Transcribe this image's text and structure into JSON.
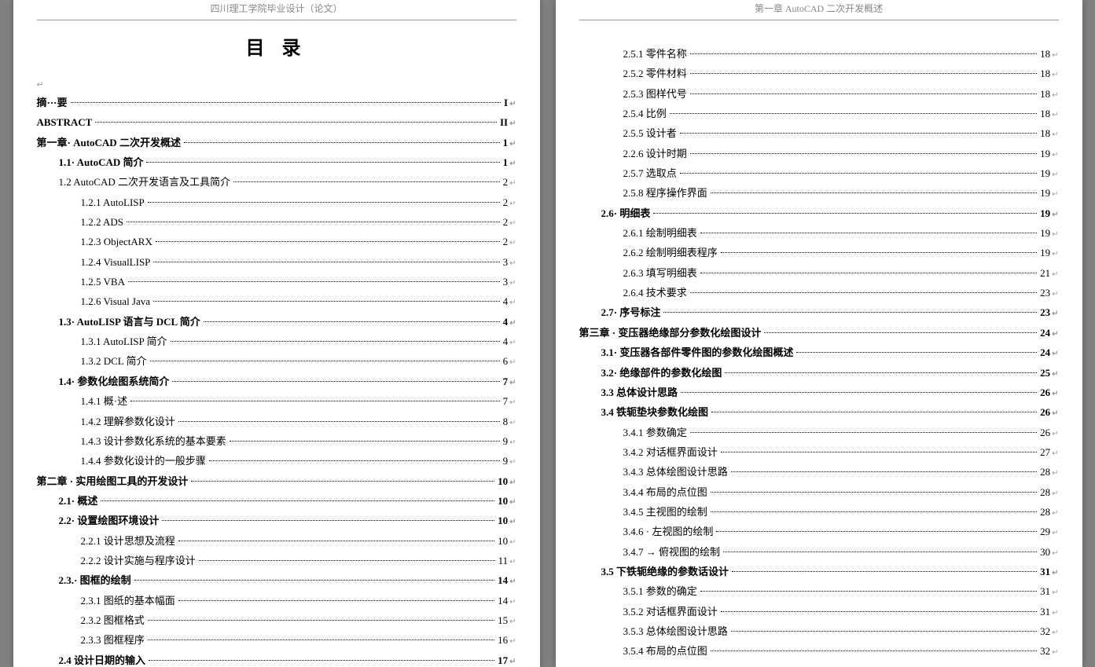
{
  "leftHeader": "四川理工学院毕业设计（论文）",
  "rightHeader": "第一章  AutoCAD 二次开发概述",
  "title": "目   录",
  "leftToc": [
    {
      "label": "摘···要",
      "page": "I",
      "indent": 0,
      "bold": true
    },
    {
      "label": "ABSTRACT",
      "page": "II",
      "indent": 0,
      "bold": true
    },
    {
      "label": "第一章· AutoCAD 二次开发概述",
      "page": "1",
      "indent": 0,
      "bold": true
    },
    {
      "label": "1.1· AutoCAD 简介",
      "page": "1",
      "indent": 1,
      "bold": true
    },
    {
      "label": "1.2 AutoCAD 二次开发语言及工具简介",
      "page": "2",
      "indent": 1,
      "bold": false
    },
    {
      "label": "1.2.1 AutoLISP",
      "page": "2",
      "indent": 2,
      "bold": false
    },
    {
      "label": "1.2.2 ADS",
      "page": "2",
      "indent": 2,
      "bold": false
    },
    {
      "label": "1.2.3 ObjectARX",
      "page": "2",
      "indent": 2,
      "bold": false
    },
    {
      "label": "1.2.4 VisualLISP",
      "page": "3",
      "indent": 2,
      "bold": false
    },
    {
      "label": "1.2.5 VBA",
      "page": "3",
      "indent": 2,
      "bold": false
    },
    {
      "label": "1.2.6 Visual Java",
      "page": "4",
      "indent": 2,
      "bold": false
    },
    {
      "label": "1.3· AutoLISP 语言与 DCL 简介",
      "page": "4",
      "indent": 1,
      "bold": true
    },
    {
      "label": "1.3.1 AutoLISP 简介",
      "page": "4",
      "indent": 2,
      "bold": false
    },
    {
      "label": "1.3.2 DCL 简介",
      "page": "6",
      "indent": 2,
      "bold": false
    },
    {
      "label": "1.4· 参数化绘图系统简介",
      "page": "7",
      "indent": 1,
      "bold": true
    },
    {
      "label": "1.4.1 概·述",
      "page": "7",
      "indent": 2,
      "bold": false
    },
    {
      "label": "1.4.2 理解参数化设计",
      "page": "8",
      "indent": 2,
      "bold": false
    },
    {
      "label": "1.4.3 设计参数化系统的基本要素",
      "page": "9",
      "indent": 2,
      "bold": false
    },
    {
      "label": "1.4.4 参数化设计的一般步骤",
      "page": "9",
      "indent": 2,
      "bold": false
    },
    {
      "label": "第二章 · 实用绘图工具的开发设计",
      "page": "10",
      "indent": 0,
      "bold": true
    },
    {
      "label": "2.1· 概述",
      "page": "10",
      "indent": 1,
      "bold": true
    },
    {
      "label": "2.2· 设置绘图环境设计",
      "page": "10",
      "indent": 1,
      "bold": true
    },
    {
      "label": "2.2.1 设计思想及流程",
      "page": "10",
      "indent": 2,
      "bold": false
    },
    {
      "label": "2.2.2 设计实施与程序设计",
      "page": "11",
      "indent": 2,
      "bold": false
    },
    {
      "label": "2.3.· 图框的绘制",
      "page": "14",
      "indent": 1,
      "bold": true
    },
    {
      "label": "2.3.1 图纸的基本幅面",
      "page": "14",
      "indent": 2,
      "bold": false
    },
    {
      "label": "2.3.2 图框格式",
      "page": "15",
      "indent": 2,
      "bold": false
    },
    {
      "label": "2.3.3 图框程序",
      "page": "16",
      "indent": 2,
      "bold": false
    },
    {
      "label": "2.4 设计日期的输入",
      "page": "17",
      "indent": 1,
      "bold": true
    }
  ],
  "rightToc": [
    {
      "label": "2.5.1 零件名称",
      "page": "18",
      "indent": 2,
      "bold": false
    },
    {
      "label": "2.5.2 零件材料",
      "page": "18",
      "indent": 2,
      "bold": false
    },
    {
      "label": "2.5.3 图样代号",
      "page": "18",
      "indent": 2,
      "bold": false
    },
    {
      "label": "2.5.4 比例",
      "page": "18",
      "indent": 2,
      "bold": false
    },
    {
      "label": "2.5.5 设计者",
      "page": "18",
      "indent": 2,
      "bold": false
    },
    {
      "label": "2.2.6 设计时期",
      "page": "19",
      "indent": 2,
      "bold": false
    },
    {
      "label": "2.5.7 选取点",
      "page": "19",
      "indent": 2,
      "bold": false
    },
    {
      "label": "2.5.8 程序操作界面",
      "page": "19",
      "indent": 2,
      "bold": false
    },
    {
      "label": "2.6· 明细表",
      "page": "19",
      "indent": 1,
      "bold": true
    },
    {
      "label": "2.6.1 绘制明细表",
      "page": "19",
      "indent": 2,
      "bold": false
    },
    {
      "label": "2.6.2 绘制明细表程序",
      "page": "19",
      "indent": 2,
      "bold": false
    },
    {
      "label": "2.6.3 填写明细表",
      "page": "21",
      "indent": 2,
      "bold": false
    },
    {
      "label": "2.6.4 技术要求",
      "page": "23",
      "indent": 2,
      "bold": false
    },
    {
      "label": "2.7· 序号标注",
      "page": "23",
      "indent": 1,
      "bold": true
    },
    {
      "label": "第三章 · 变压器绝缘部分参数化绘图设计",
      "page": "24",
      "indent": 0,
      "bold": true
    },
    {
      "label": "3.1· 变压器各部件零件图的参数化绘图概述",
      "page": "24",
      "indent": 1,
      "bold": true
    },
    {
      "label": "3.2· 绝缘部件的参数化绘图",
      "page": "25",
      "indent": 1,
      "bold": true
    },
    {
      "label": "3.3 总体设计思路",
      "page": "26",
      "indent": 1,
      "bold": true
    },
    {
      "label": "3.4 铁轭垫块参数化绘图",
      "page": "26",
      "indent": 1,
      "bold": true
    },
    {
      "label": "3.4.1 参数确定",
      "page": "26",
      "indent": 2,
      "bold": false
    },
    {
      "label": "3.4.2 对话框界面设计",
      "page": "27",
      "indent": 2,
      "bold": false
    },
    {
      "label": "3.4.3 总体绘图设计思路",
      "page": "28",
      "indent": 2,
      "bold": false
    },
    {
      "label": "3.4.4 布局的点位图",
      "page": "28",
      "indent": 2,
      "bold": false
    },
    {
      "label": "3.4.5 主视图的绘制",
      "page": "28",
      "indent": 2,
      "bold": false
    },
    {
      "label": "3.4.6 · 左视图的绘制",
      "page": "29",
      "indent": 2,
      "bold": false
    },
    {
      "label": "3.4.7 → 俯视图的绘制",
      "page": "30",
      "indent": 2,
      "bold": false
    },
    {
      "label": "3.5 下铁轭绝缘的参数话设计",
      "page": "31",
      "indent": 1,
      "bold": true
    },
    {
      "label": "3.5.1 参数的确定",
      "page": "31",
      "indent": 2,
      "bold": false
    },
    {
      "label": "3.5.2 对话框界面设计",
      "page": "31",
      "indent": 2,
      "bold": false
    },
    {
      "label": "3.5.3 总体绘图设计思路",
      "page": "32",
      "indent": 2,
      "bold": false
    },
    {
      "label": "3.5.4 布局的点位图",
      "page": "32",
      "indent": 2,
      "bold": false
    }
  ]
}
